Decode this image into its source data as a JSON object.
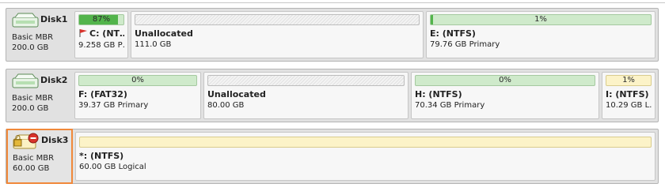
{
  "colors": {
    "selection_border": "#f0883a",
    "used_fill": "#52b44b",
    "primary_bar": "#cfeacb",
    "logical_bar": "#fcf3c8"
  },
  "disks": [
    {
      "name": "Disk1",
      "type": "Basic MBR",
      "size": "200.0 GB",
      "icon": "hard-disk-icon",
      "partitions": [
        {
          "percent": "87%",
          "used_fraction": 0.87,
          "label": "C: (NT…",
          "info": "9.258 GB P…",
          "flag_icon": "flag-icon"
        },
        {
          "percent": "",
          "label": "Unallocated",
          "info": "111.0 GB"
        },
        {
          "percent": "1%",
          "used_fraction": 0.01,
          "label": "E: (NTFS)",
          "info": "79.76 GB Primary"
        }
      ]
    },
    {
      "name": "Disk2",
      "type": "Basic MBR",
      "size": "200.0 GB",
      "icon": "hard-disk-icon",
      "partitions": [
        {
          "percent": "0%",
          "used_fraction": 0.0,
          "label": "F: (FAT32)",
          "info": "39.37 GB Primary"
        },
        {
          "percent": "",
          "label": "Unallocated",
          "info": "80.00 GB"
        },
        {
          "percent": "0%",
          "used_fraction": 0.0,
          "label": "H: (NTFS)",
          "info": "70.34 GB Primary"
        },
        {
          "percent": "1%",
          "used_fraction": 0.01,
          "label": "I: (NTFS)",
          "info": "10.29 GB L…"
        }
      ]
    },
    {
      "name": "Disk3",
      "type": "Basic MBR",
      "size": "60.00 GB",
      "icon": "locked-disk-icon",
      "partitions": [
        {
          "percent": "",
          "used_fraction": 0.0,
          "label": "*: (NTFS)",
          "info": "60.00 GB Logical"
        }
      ]
    }
  ]
}
